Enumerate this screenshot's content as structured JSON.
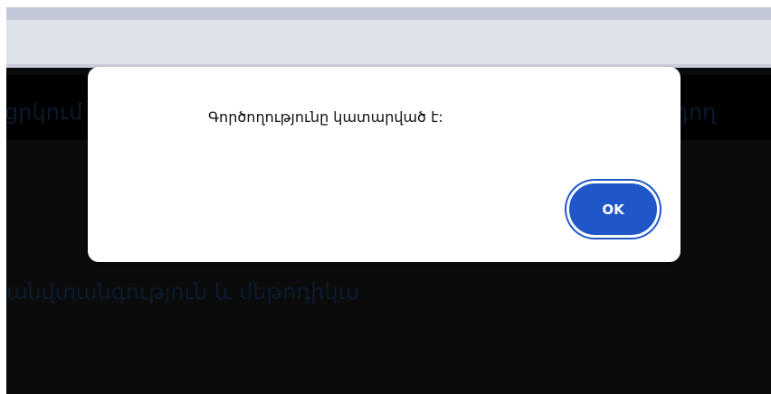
{
  "background": {
    "nav_left": "ցրկում",
    "nav_right": "դող",
    "heading": "անվտանգություն և մեթոդիկա"
  },
  "dialog": {
    "message": "Գործողությունը կատարված է:",
    "ok_label": "OK"
  },
  "colors": {
    "accent": "#1f57c8",
    "page_background": "#0b0b0b",
    "browser_bar": "#dde1ea"
  }
}
